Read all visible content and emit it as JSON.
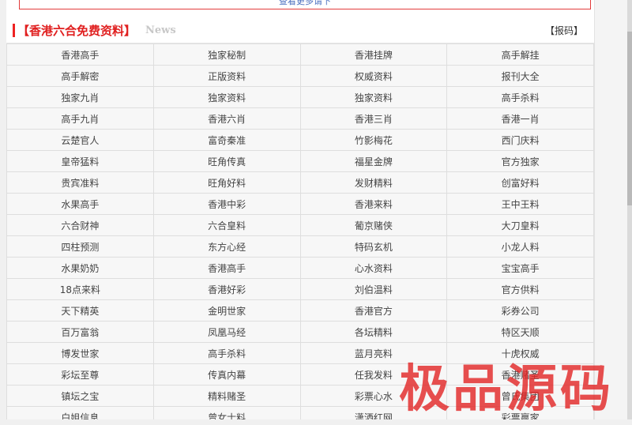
{
  "top_notice": "查看更多请下",
  "section": {
    "title": "【香港六合免费资料】",
    "news_label": "News",
    "report_link": "【报码】"
  },
  "grid_rows": [
    [
      "香港高手",
      "独家秘制",
      "香港挂牌",
      "高手解挂"
    ],
    [
      "高手解密",
      "正版资料",
      "权威资料",
      "报刊大全"
    ],
    [
      "独家九肖",
      "独家资料",
      "独家资料",
      "高手杀料"
    ],
    [
      "高手九肖",
      "香港六肖",
      "香港三肖",
      "香港一肖"
    ],
    [
      "云楚官人",
      "富奇秦准",
      "竹影梅花",
      "西门庆料"
    ],
    [
      "皇帝猛料",
      "旺角传真",
      "福星金牌",
      "官方独家"
    ],
    [
      "贵宾准料",
      "旺角好料",
      "发财精料",
      "创富好料"
    ],
    [
      "水果高手",
      "香港中彩",
      "香港来料",
      "王中王料"
    ],
    [
      "六合财神",
      "六合皇料",
      "葡京赌侠",
      "大刀皇料"
    ],
    [
      "四柱预测",
      "东方心经",
      "特码玄机",
      "小龙人料"
    ],
    [
      "水果奶奶",
      "香港高手",
      "心水资料",
      "宝宝高手"
    ],
    [
      "18点来料",
      "香港好彩",
      "刘伯温料",
      "官方供料"
    ],
    [
      "天下精英",
      "金明世家",
      "香港官方",
      "彩券公司"
    ],
    [
      "百万富翁",
      "凤凰马经",
      "各坛精料",
      "特区天顺"
    ],
    [
      "博发世家",
      "高手杀料",
      "蓝月亮料",
      "十虎权威"
    ],
    [
      "彩坛至尊",
      "传真内幕",
      "任我发料",
      "香港赌圣"
    ],
    [
      "镇坛之宝",
      "精料赌圣",
      "彩票心水",
      "曾氏集团"
    ],
    [
      "白姐信息",
      "曾女士料",
      "潇洒红网",
      "彩票赢家"
    ]
  ],
  "watermark": "极品源码"
}
